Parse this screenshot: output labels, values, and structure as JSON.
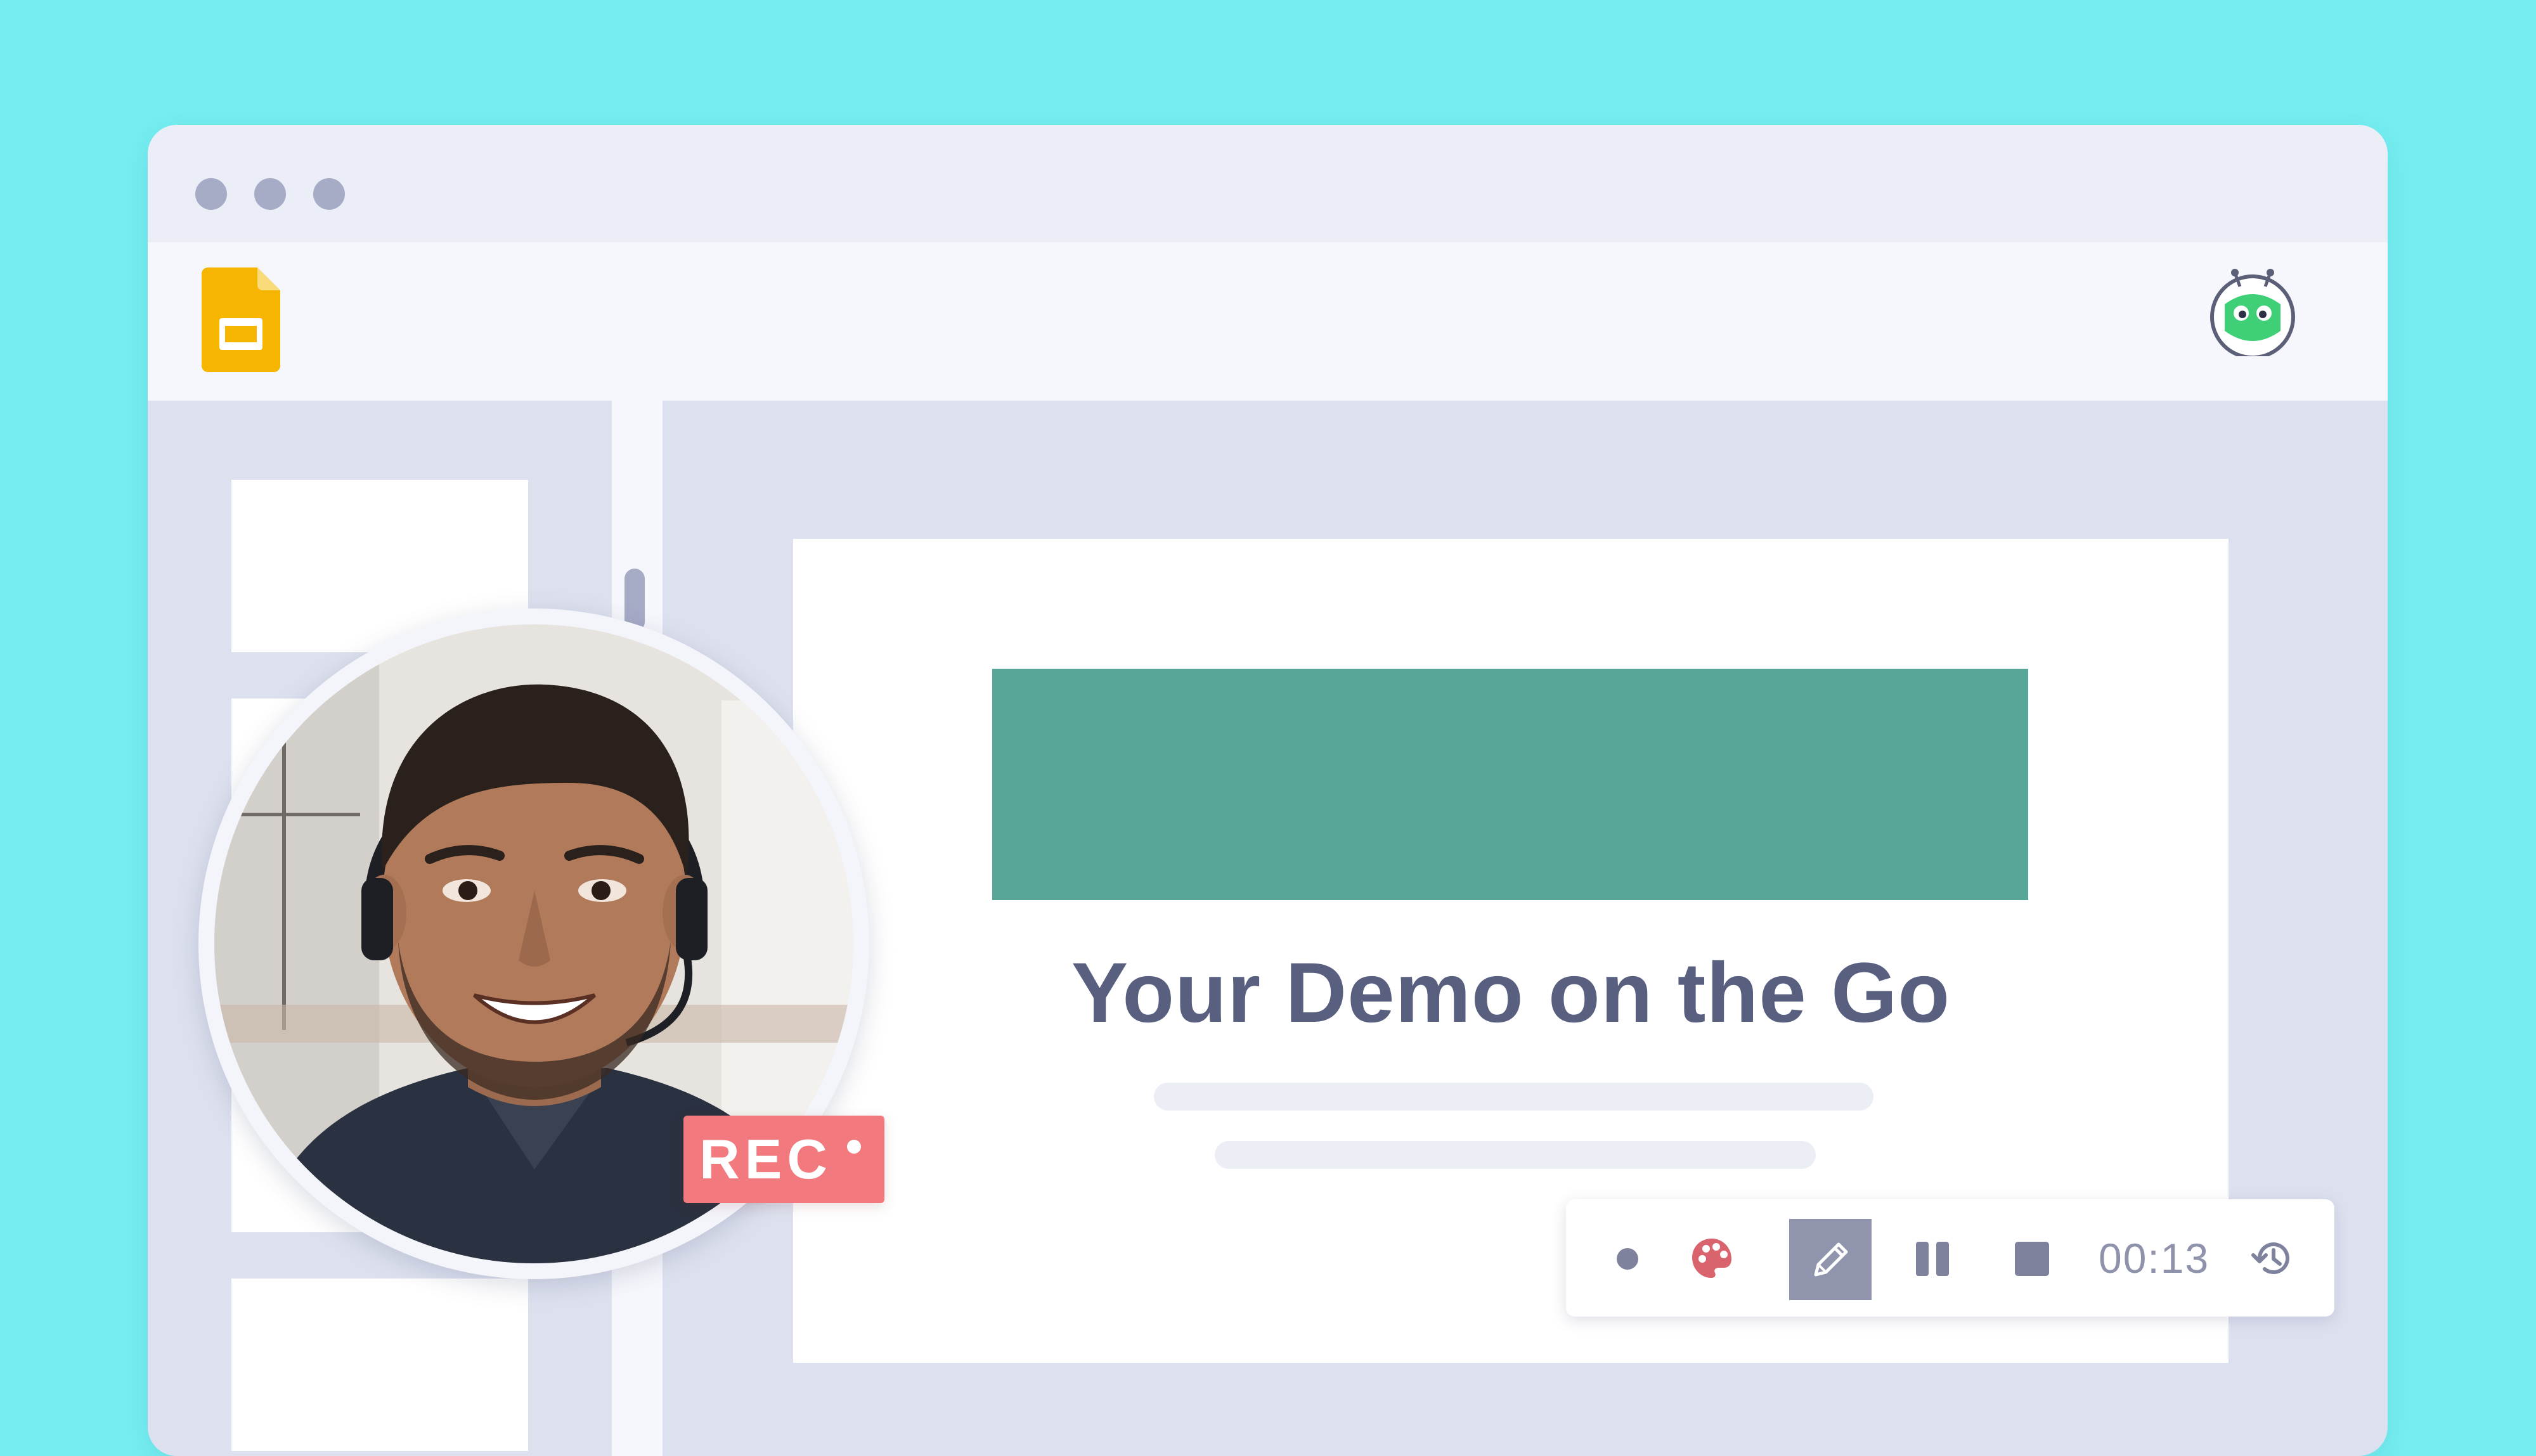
{
  "app": {
    "name": "Google Slides",
    "extension": "Recording extension"
  },
  "slide": {
    "title": "Your Demo on the Go",
    "banner_color": "#58a698"
  },
  "recorder": {
    "badge_label": "REC",
    "timer": "00:13",
    "controls": [
      "record-dot",
      "palette",
      "pen",
      "pause",
      "stop",
      "timer",
      "history"
    ],
    "active_tool": "pen"
  },
  "colors": {
    "background": "#74eef1",
    "rec_badge": "#f27a7e",
    "slides_logo": "#f5b500",
    "bot_logo": "#3ecf77"
  }
}
